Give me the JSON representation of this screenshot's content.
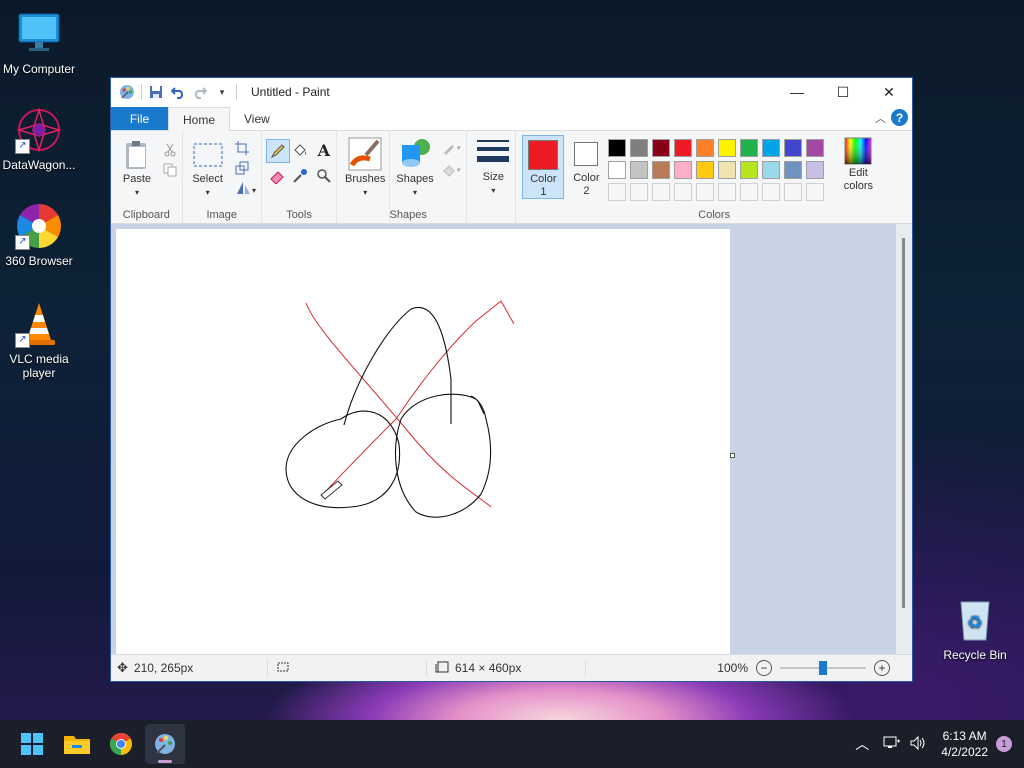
{
  "desktop": {
    "icons": [
      {
        "label": "My Computer"
      },
      {
        "label": "DataWagon..."
      },
      {
        "label": "360 Browser"
      },
      {
        "label": "VLC media player"
      },
      {
        "label": "Recycle Bin"
      }
    ]
  },
  "window": {
    "title": "Untitled - Paint",
    "tabs": {
      "file": "File",
      "home": "Home",
      "view": "View"
    },
    "help": "?",
    "controls": {
      "minimize": "—",
      "maximize": "☐",
      "close": "✕"
    }
  },
  "ribbon": {
    "clipboard": {
      "label": "Clipboard",
      "paste": "Paste"
    },
    "image": {
      "label": "Image",
      "select": "Select"
    },
    "tools": {
      "label": "Tools"
    },
    "brushes": {
      "label": "Brushes"
    },
    "shapes": {
      "label": "Shapes",
      "shapes_btn": "Shapes"
    },
    "size": {
      "label": "Size"
    },
    "colors": {
      "label": "Colors",
      "color1": "Color 1",
      "color1_line1": "Color",
      "color1_line2": "1",
      "color2_line1": "Color",
      "color2_line2": "2",
      "edit_line1": "Edit",
      "edit_line2": "colors",
      "color1_value": "#ed1c24",
      "color2_value": "#ffffff",
      "palette_row1": [
        "#000000",
        "#7f7f7f",
        "#880015",
        "#ed1c24",
        "#ff7f27",
        "#fff200",
        "#22b14c",
        "#00a2e8",
        "#3f48cc",
        "#a349a4"
      ],
      "palette_row2": [
        "#ffffff",
        "#c3c3c3",
        "#b97a57",
        "#ffaec9",
        "#ffc90e",
        "#efe4b0",
        "#b5e61d",
        "#99d9ea",
        "#7092be",
        "#c8bfe7"
      ]
    }
  },
  "status": {
    "cursor_pos": "210, 265px",
    "canvas_size": "614 × 460px",
    "zoom": "100%"
  },
  "taskbar": {
    "time": "6:13 AM",
    "date": "4/2/2022",
    "notifications": "1"
  }
}
